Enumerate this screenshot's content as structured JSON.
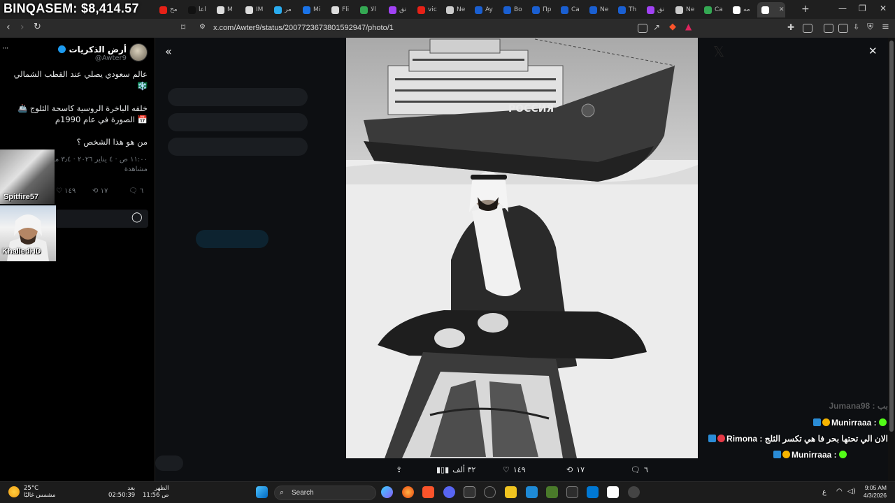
{
  "stream_overlay": {
    "ticker": "BINQASEM: $8,414.57",
    "cam_labels": [
      "Spitfire57",
      "KhalledHD"
    ]
  },
  "browser": {
    "tabs": [
      {
        "label": "مح",
        "icon": "youtube-icon",
        "color": "#e62117"
      },
      {
        "label": "اعا",
        "icon": "tiktok-icon",
        "color": "#111111"
      },
      {
        "label": "M",
        "icon": "chatgpt-icon",
        "color": "#dddddd"
      },
      {
        "label": "IM",
        "icon": "chatgpt-icon",
        "color": "#dddddd"
      },
      {
        "label": "مر",
        "icon": "telegram-icon",
        "color": "#2aabee"
      },
      {
        "label": "Mi",
        "icon": "shield-icon",
        "color": "#1a73e8"
      },
      {
        "label": "Fli",
        "icon": "clock-icon",
        "color": "#dddddd"
      },
      {
        "label": "الا",
        "icon": "maps-pin-icon",
        "color": "#34a853"
      },
      {
        "label": "تق",
        "icon": "pen-icon",
        "color": "#a142f4"
      },
      {
        "label": "vic",
        "icon": "youtube-icon",
        "color": "#e62117"
      },
      {
        "label": "Ne",
        "icon": "shield-icon",
        "color": "#cccccc"
      },
      {
        "label": "Ay",
        "icon": "bing-icon",
        "color": "#1a5fd1"
      },
      {
        "label": "Bo",
        "icon": "bing-icon",
        "color": "#1a5fd1"
      },
      {
        "label": "Пр",
        "icon": "bing-icon",
        "color": "#1a5fd1"
      },
      {
        "label": "Ca",
        "icon": "bing-icon",
        "color": "#1a5fd1"
      },
      {
        "label": "Ne",
        "icon": "bing-icon",
        "color": "#1a5fd1"
      },
      {
        "label": "Th",
        "icon": "bing-icon",
        "color": "#1a5fd1"
      },
      {
        "label": "تق",
        "icon": "pen-icon",
        "color": "#a142f4"
      },
      {
        "label": "Ne",
        "icon": "shield-icon",
        "color": "#cccccc"
      },
      {
        "label": "Ca",
        "icon": "maps-pin-icon",
        "color": "#34a853"
      },
      {
        "label": "مه",
        "icon": "google-icon",
        "color": "#ffffff"
      },
      {
        "label": "",
        "icon": "x-logo-icon",
        "color": "#ffffff",
        "active": true
      }
    ],
    "url": "x.com/Awter9/status/2007723673801592947/photo/1"
  },
  "tweet": {
    "author_name": "أرض الذكريات",
    "author_handle": "@Awter9",
    "line1": "عالم سعودي يصلي عند القطب الشمالي 🇸🇦",
    "line1b": "❄️",
    "line2": "خلفه الباخرة الروسية كاسحة الثلوج 🚢",
    "line3": "📅 الصورة في عام 1990م",
    "line4": "من هو هذا الشخص ؟",
    "meta_time": "١١:٠٠ ص · ٤ يناير ٢٠٢٦ · ٣٫٤ مرات",
    "meta_views": "مشاهدة",
    "replies": "٦",
    "retweets": "١٧",
    "likes": "١٤٩"
  },
  "viewer": {
    "ship_name": "РОССИЯ",
    "views_label": "٣٢ ألف",
    "likes": "١٤٩",
    "retweets": "١٧",
    "replies": "٦"
  },
  "chat": [
    {
      "user": "Jumana98 :",
      "text": "بب",
      "faded": true
    },
    {
      "user": "Munirraaa :",
      "text": "",
      "emote": true
    },
    {
      "user": "Rimona :",
      "text": "الان الي تحتها بحر فا هي تكسر الثلج"
    },
    {
      "user": "Munirraaa :",
      "text": "",
      "emote": true
    }
  ],
  "taskbar": {
    "temp": "25°C",
    "weather_desc": "مشمس غالبًا",
    "clock1_label": "بعد",
    "clock1_time": "02:50:39",
    "clock2_label": "الظهر",
    "clock2_time": "11:56 ص",
    "search": "Search",
    "sys_time": "9:05 AM",
    "sys_date": "4/3/2026",
    "lang": "ع"
  }
}
